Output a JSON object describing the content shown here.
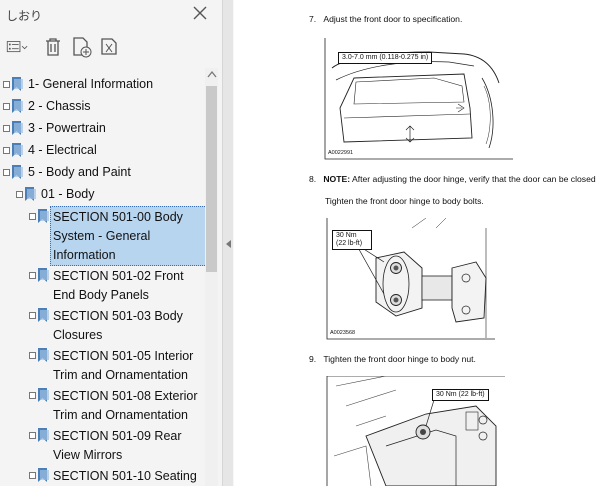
{
  "panel": {
    "title": "しおり",
    "toolbar": {
      "options_icon": "list-options-icon",
      "delete_icon": "trash-icon",
      "new_icon": "new-bookmark-icon",
      "tag_icon": "tag-bookmark-icon"
    },
    "tree": [
      {
        "label": "1- General Information"
      },
      {
        "label": "2 - Chassis"
      },
      {
        "label": "3 - Powertrain"
      },
      {
        "label": "4 - Electrical"
      },
      {
        "label": "5 - Body and Paint"
      },
      {
        "label": "01 - Body"
      }
    ],
    "sections": [
      {
        "line1": "SECTION 501-00 Body",
        "line2": "System - General",
        "line3": "Information"
      },
      {
        "line1": "SECTION 501-02 Front",
        "line2": "End Body Panels"
      },
      {
        "line1": "SECTION 501-03 Body",
        "line2": "Closures"
      },
      {
        "line1": "SECTION 501-05 Interior",
        "line2": "Trim and Ornamentation"
      },
      {
        "line1": "SECTION 501-08 Exterior",
        "line2": "Trim and Ornamentation"
      },
      {
        "line1": "SECTION 501-09 Rear",
        "line2": "View Mirrors"
      },
      {
        "line1": "SECTION 501-10 Seating"
      }
    ]
  },
  "document": {
    "step7": {
      "num": "7.",
      "text": "Adjust the front door to specification."
    },
    "fig1": {
      "callout": "3.0-7.0 mm (0.118-0.275 in)",
      "code": "A0022991"
    },
    "step8": {
      "num": "8.",
      "note": "NOTE:",
      "text": "After adjusting the door hinge, verify that the door can be closed"
    },
    "step8b": {
      "text": "Tighten the front door hinge to body bolts."
    },
    "fig2": {
      "callout_line1": "30 Nm",
      "callout_line2": "(22 lb-ft)",
      "code": "A0023568"
    },
    "step9": {
      "num": "9.",
      "text": "Tighten the front door hinge to body nut."
    },
    "fig3": {
      "callout": "30 Nm (22 lb-ft)"
    }
  },
  "colors": {
    "selection": "#b8d5f0",
    "bookmark_icon": "#4a7fb8"
  }
}
